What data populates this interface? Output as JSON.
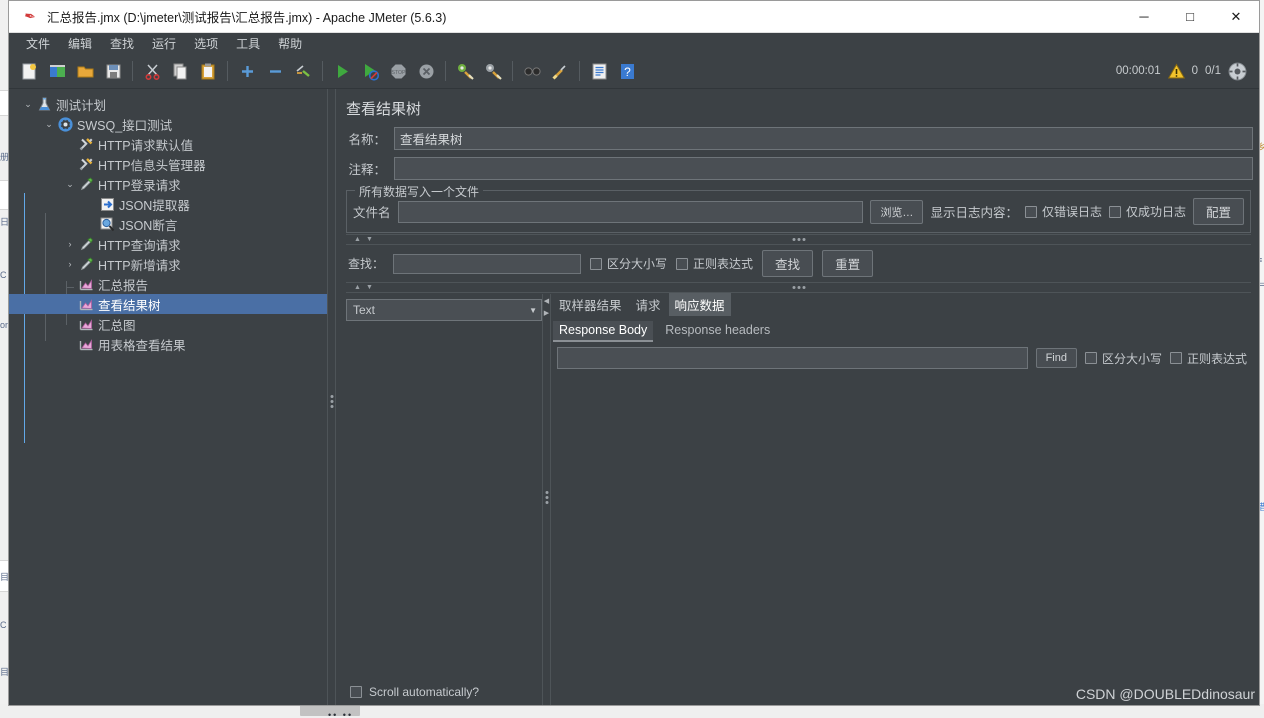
{
  "window": {
    "title": "汇总报告.jmx (D:\\jmeter\\测试报告\\汇总报告.jmx) - Apache JMeter (5.6.3)",
    "minimize": "─",
    "maximize": "□",
    "close": "✕"
  },
  "menubar": [
    {
      "label": "文件"
    },
    {
      "label": "编辑"
    },
    {
      "label": "查找"
    },
    {
      "label": "运行"
    },
    {
      "label": "选项"
    },
    {
      "label": "工具"
    },
    {
      "label": "帮助"
    }
  ],
  "toolbar": {
    "buttons": [
      {
        "name": "new-icon"
      },
      {
        "name": "templates-icon"
      },
      {
        "name": "open-icon"
      },
      {
        "name": "save-icon"
      },
      {
        "name": "cut-icon"
      },
      {
        "name": "copy-icon"
      },
      {
        "name": "paste-icon"
      },
      {
        "name": "expand-all-icon"
      },
      {
        "name": "collapse-all-icon"
      },
      {
        "name": "toggle-icon"
      },
      {
        "name": "start-icon"
      },
      {
        "name": "start-no-pauses-icon"
      },
      {
        "name": "stop-icon"
      },
      {
        "name": "shutdown-icon"
      },
      {
        "name": "clear-icon"
      },
      {
        "name": "clear-all-icon"
      },
      {
        "name": "search-icon"
      },
      {
        "name": "reset-search-icon"
      },
      {
        "name": "function-helper-icon"
      },
      {
        "name": "help-icon"
      }
    ],
    "timer": "00:00:01",
    "warning_count": "0",
    "thread_count": "0/1"
  },
  "tree": {
    "nodes": [
      {
        "label": "测试计划",
        "depth": 0,
        "arrow": "⌄",
        "icon": "test-plan-icon",
        "selected": false
      },
      {
        "label": "SWSQ_接口测试",
        "depth": 1,
        "arrow": "⌄",
        "icon": "thread-group-icon",
        "selected": false
      },
      {
        "label": "HTTP请求默认值",
        "depth": 2,
        "arrow": "",
        "icon": "config-defaults-icon",
        "selected": false
      },
      {
        "label": "HTTP信息头管理器",
        "depth": 2,
        "arrow": "",
        "icon": "header-manager-icon",
        "selected": false
      },
      {
        "label": "HTTP登录请求",
        "depth": 2,
        "arrow": "⌄",
        "icon": "http-sampler-icon",
        "selected": false
      },
      {
        "label": "JSON提取器",
        "depth": 3,
        "arrow": "",
        "icon": "json-extractor-icon",
        "selected": false
      },
      {
        "label": "JSON断言",
        "depth": 3,
        "arrow": "",
        "icon": "json-assertion-icon",
        "selected": false
      },
      {
        "label": "HTTP查询请求",
        "depth": 2,
        "arrow": "›",
        "icon": "http-sampler-icon",
        "selected": false
      },
      {
        "label": "HTTP新增请求",
        "depth": 2,
        "arrow": "›",
        "icon": "http-sampler-icon",
        "selected": false
      },
      {
        "label": "汇总报告",
        "depth": 2,
        "arrow": "",
        "icon": "listener-icon",
        "selected": false
      },
      {
        "label": "查看结果树",
        "depth": 2,
        "arrow": "",
        "icon": "listener-icon",
        "selected": true
      },
      {
        "label": "汇总图",
        "depth": 2,
        "arrow": "",
        "icon": "listener-icon",
        "selected": false
      },
      {
        "label": "用表格查看结果",
        "depth": 2,
        "arrow": "",
        "icon": "listener-icon",
        "selected": false
      }
    ]
  },
  "panel": {
    "title": "查看结果树",
    "name_label": "名称：",
    "name_value": "查看结果树",
    "comment_label": "注释：",
    "comment_value": "",
    "comment_placeholder": "",
    "filegroup": {
      "title": "所有数据写入一个文件",
      "filename_label": "文件名",
      "filename_value": "",
      "browse_label": "浏览…",
      "log_display_label": "显示日志内容：",
      "errors_only_label": "仅错误日志",
      "success_only_label": "仅成功日志",
      "configure_label": "配置"
    },
    "search": {
      "label": "查找：",
      "value": "",
      "case_sensitive_label": "区分大小写",
      "regex_label": "正则表达式",
      "find_label": "查找",
      "reset_label": "重置"
    },
    "renderer": {
      "selected": "Text",
      "caret": "▼"
    },
    "scroll_auto_label": "Scroll automatically?",
    "tabs": [
      {
        "label": "取样器结果",
        "active": false
      },
      {
        "label": "请求",
        "active": false
      },
      {
        "label": "响应数据",
        "active": true
      }
    ],
    "subtabs": [
      {
        "label": "Response Body",
        "active": true
      },
      {
        "label": "Response headers",
        "active": false
      }
    ],
    "find": {
      "value": "",
      "button_label": "Find",
      "case_sensitive_label": "区分大小写",
      "regex_label": "正则表达式"
    }
  },
  "watermark": "CSDN @DOUBLEDdinosaur",
  "colors": {
    "background": "#3c4145",
    "selection": "#4a6fa5",
    "text": "#c6cace",
    "field": "#4a4f54",
    "border": "#6e7479",
    "accent_blue": "#62a8e8"
  }
}
